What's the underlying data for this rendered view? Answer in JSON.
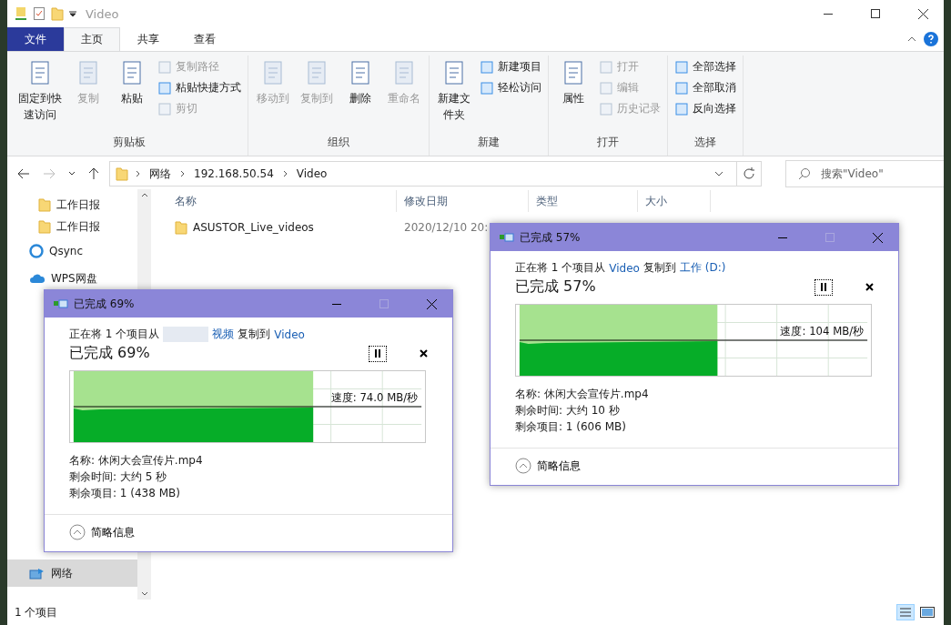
{
  "window": {
    "title": "Video"
  },
  "tabs": [
    {
      "label": "文件",
      "kind": "file",
      "selected": false
    },
    {
      "label": "主页",
      "kind": "tab",
      "selected": true
    },
    {
      "label": "共享",
      "kind": "tab",
      "selected": false
    },
    {
      "label": "查看",
      "kind": "tab",
      "selected": false
    }
  ],
  "ribbon": [
    {
      "name": "剪贴板",
      "large": [
        {
          "label": "固定到快速访问",
          "disabled": false
        },
        {
          "label": "复制",
          "disabled": true
        },
        {
          "label": "粘贴",
          "disabled": false
        }
      ],
      "small": [
        {
          "label": "剪切",
          "disabled": true
        }
      ],
      "side": [
        {
          "label": "复制路径",
          "disabled": true
        },
        {
          "label": "粘贴快捷方式",
          "disabled": false
        }
      ]
    },
    {
      "name": "组织",
      "large": [
        {
          "label": "移动到",
          "disabled": true
        },
        {
          "label": "复制到",
          "disabled": true
        },
        {
          "label": "删除",
          "disabled": false
        },
        {
          "label": "重命名",
          "disabled": true
        }
      ]
    },
    {
      "name": "新建",
      "large": [
        {
          "label": "新建文件夹",
          "disabled": false
        }
      ],
      "side": [
        {
          "label": "新建项目",
          "disabled": false
        },
        {
          "label": "轻松访问",
          "disabled": false
        }
      ]
    },
    {
      "name": "打开",
      "large": [
        {
          "label": "属性",
          "disabled": false
        }
      ],
      "side": [
        {
          "label": "打开",
          "disabled": true
        },
        {
          "label": "编辑",
          "disabled": true
        },
        {
          "label": "历史记录",
          "disabled": true
        }
      ]
    },
    {
      "name": "选择",
      "side": [
        {
          "label": "全部选择",
          "disabled": false
        },
        {
          "label": "全部取消",
          "disabled": false
        },
        {
          "label": "反向选择",
          "disabled": false
        }
      ]
    }
  ],
  "address": {
    "path": [
      "网络",
      "192.168.50.54",
      "Video"
    ],
    "search_placeholder": "搜索\"Video\""
  },
  "sidebar": {
    "items": [
      {
        "label": "工作日报",
        "kind": "folder",
        "selected": false
      },
      {
        "label": "工作日报",
        "kind": "folder",
        "selected": false
      },
      {
        "label": "Qsync",
        "kind": "sync",
        "selected": false
      },
      {
        "label": "WPS网盘",
        "kind": "cloud",
        "selected": false
      },
      {
        "label": "网络",
        "kind": "network",
        "selected": true
      }
    ]
  },
  "table": {
    "columns": [
      "名称",
      "修改日期",
      "类型",
      "大小"
    ],
    "rows": [
      {
        "name": "ASUSTOR_Live_videos",
        "modified": "2020/12/10 20:"
      }
    ]
  },
  "status_bar": "1 个项目",
  "dialogs": [
    {
      "title": "已完成 69%",
      "prefix": "正在将 1 个项目从",
      "source_redacted": true,
      "source": "视频",
      "middle": "复制到",
      "dest": "Video",
      "heading": "已完成 69%",
      "level": 0.69,
      "speed": "速度: 74.0 MB/秒",
      "details": [
        "名称: 休闲大会宣传片.mp4",
        "剩余时间: 大约 5 秒",
        "剩余项目: 1 (438 MB)"
      ],
      "footer": "简略信息"
    },
    {
      "title": "已完成 57%",
      "prefix": "正在将 1 个项目从",
      "source_redacted": false,
      "source": "Video",
      "middle": "复制到",
      "dest": "工作 (D:)",
      "heading": "已完成 57%",
      "level": 0.57,
      "speed": "速度: 104 MB/秒",
      "details": [
        "名称: 休闲大会宣传片.mp4",
        "剩余时间: 大约 10 秒",
        "剩余项目: 1 (606 MB)"
      ],
      "footer": "简略信息"
    }
  ]
}
